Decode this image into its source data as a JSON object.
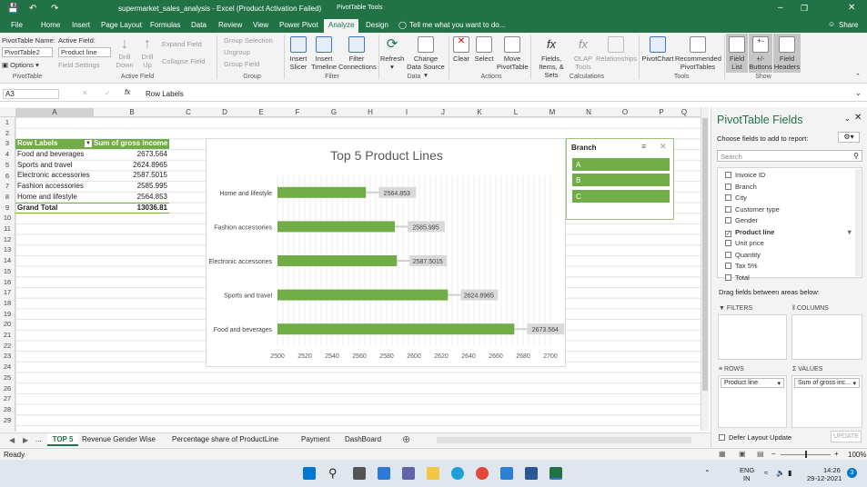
{
  "window": {
    "title": "supermarket_sales_analysis - Excel (Product Activation Failed)",
    "context": "PivotTable Tools",
    "quick_access_icons": [
      "save-icon",
      "undo-icon",
      "redo-icon"
    ],
    "account_initial": ""
  },
  "ribbon_tabs": [
    "File",
    "Home",
    "Insert",
    "Page Layout",
    "Formulas",
    "Data",
    "Review",
    "View",
    "Power Pivot",
    "Analyze",
    "Design"
  ],
  "active_tab": "Analyze",
  "tell_me": "Tell me what you want to do...",
  "share": "Share",
  "ribbon": {
    "pivot_name_label": "PivotTable Name:",
    "pivot_name": "PivotTable2",
    "options": "Options",
    "active_field_label": "Active Field:",
    "active_field": "Product line",
    "field_settings": "Field Settings",
    "drill_down": "Drill Down",
    "drill_up": "Drill Up",
    "expand_field": "Expand Field",
    "collapse_field": "Collapse Field",
    "group_selection": "Group Selection",
    "ungroup": "Ungroup",
    "group_field": "Group Field",
    "insert_slicer": "Insert Slicer",
    "insert_timeline": "Insert Timeline",
    "filter_connections": "Filter Connections",
    "refresh": "Refresh",
    "change_data_source": "Change Data Source",
    "clear": "Clear",
    "select": "Select",
    "move_pivottable": "Move PivotTable",
    "fields_items_sets": "Fields, Items, & Sets",
    "olap_tools": "OLAP Tools",
    "relationships": "Relationships",
    "pivotchart": "PivotChart",
    "recommended_pivottables": "Recommended PivotTables",
    "field_list": "Field List",
    "buttons": "+/- Buttons",
    "field_headers": "Field Headers",
    "groups": {
      "pivottable": "PivotTable",
      "active_field": "Active Field",
      "group": "Group",
      "filter": "Filter",
      "data": "Data",
      "actions": "Actions",
      "calculations": "Calculations",
      "tools": "Tools",
      "show": "Show"
    }
  },
  "name_box": "A3",
  "formula": "Row Labels",
  "columns": [
    "A",
    "B",
    "C",
    "D",
    "E",
    "F",
    "G",
    "H",
    "I",
    "J",
    "K",
    "L",
    "M",
    "N",
    "O",
    "P",
    "Q"
  ],
  "rows": [
    "1",
    "2",
    "3",
    "4",
    "5",
    "6",
    "7",
    "8",
    "9",
    "10",
    "11",
    "12",
    "13",
    "14",
    "15",
    "16",
    "17",
    "18",
    "19",
    "20",
    "21",
    "22",
    "23",
    "24",
    "25",
    "26",
    "27",
    "28",
    "29"
  ],
  "pivot": {
    "header": [
      "Row Labels",
      "Sum of gross income"
    ],
    "rows": [
      [
        "Food and beverages",
        "2673.564"
      ],
      [
        "Sports and travel",
        "2624.8965"
      ],
      [
        "Electronic accessories",
        "2587.5015"
      ],
      [
        "Fashion accessories",
        "2585.995"
      ],
      [
        "Home and lifestyle",
        "2564.853"
      ]
    ],
    "total": [
      "Grand Total",
      "13036.81"
    ]
  },
  "chart_data": {
    "type": "bar",
    "orientation": "horizontal",
    "title": "Top 5 Product Lines",
    "categories": [
      "Home and lifestyle",
      "Fashion accessories",
      "Electronic accessories",
      "Sports and travel",
      "Food and beverages"
    ],
    "values": [
      2564.853,
      2585.995,
      2587.5015,
      2624.8965,
      2673.564
    ],
    "labels": [
      "2564.853",
      "2585.995",
      "2587.5015",
      "2624.8965",
      "2673.564"
    ],
    "xlim": [
      2500,
      2700
    ],
    "ticks": [
      "2500",
      "2520",
      "2540",
      "2560",
      "2580",
      "2600",
      "2620",
      "2640",
      "2660",
      "2680",
      "2700"
    ],
    "color": "#70ad47",
    "grid": true
  },
  "slicer": {
    "title": "Branch",
    "items": [
      "A",
      "B",
      "C"
    ]
  },
  "pane": {
    "title": "PivotTable Fields",
    "subtitle": "Choose fields to add to report:",
    "search_placeholder": "Search",
    "fields": [
      {
        "name": "Invoice ID",
        "checked": false
      },
      {
        "name": "Branch",
        "checked": false
      },
      {
        "name": "City",
        "checked": false
      },
      {
        "name": "Customer type",
        "checked": false
      },
      {
        "name": "Gender",
        "checked": false
      },
      {
        "name": "Product line",
        "checked": true
      },
      {
        "name": "Unit price",
        "checked": false
      },
      {
        "name": "Quantity",
        "checked": false
      },
      {
        "name": "Tax 5%",
        "checked": false
      },
      {
        "name": "Total",
        "checked": false
      }
    ],
    "drag_hint": "Drag fields between areas below:",
    "filters": "FILTERS",
    "columns": "COLUMNS",
    "rows": "ROWS",
    "values": "VALUES",
    "rows_item": "Product line",
    "values_item": "Sum of gross inc...",
    "defer": "Defer Layout Update",
    "update": "UPDATE"
  },
  "sheets": [
    "TOP 5",
    "Revenue Gender Wise",
    "Percentage share of ProductLine",
    "Payment",
    "DashBoard"
  ],
  "active_sheet": "TOP 5",
  "status": {
    "ready": "Ready",
    "zoom": "100%"
  },
  "taskbar": {
    "lang": "ENG",
    "lang2": "IN",
    "time": "14:26",
    "date": "29-12-2021",
    "notifications": "3"
  }
}
